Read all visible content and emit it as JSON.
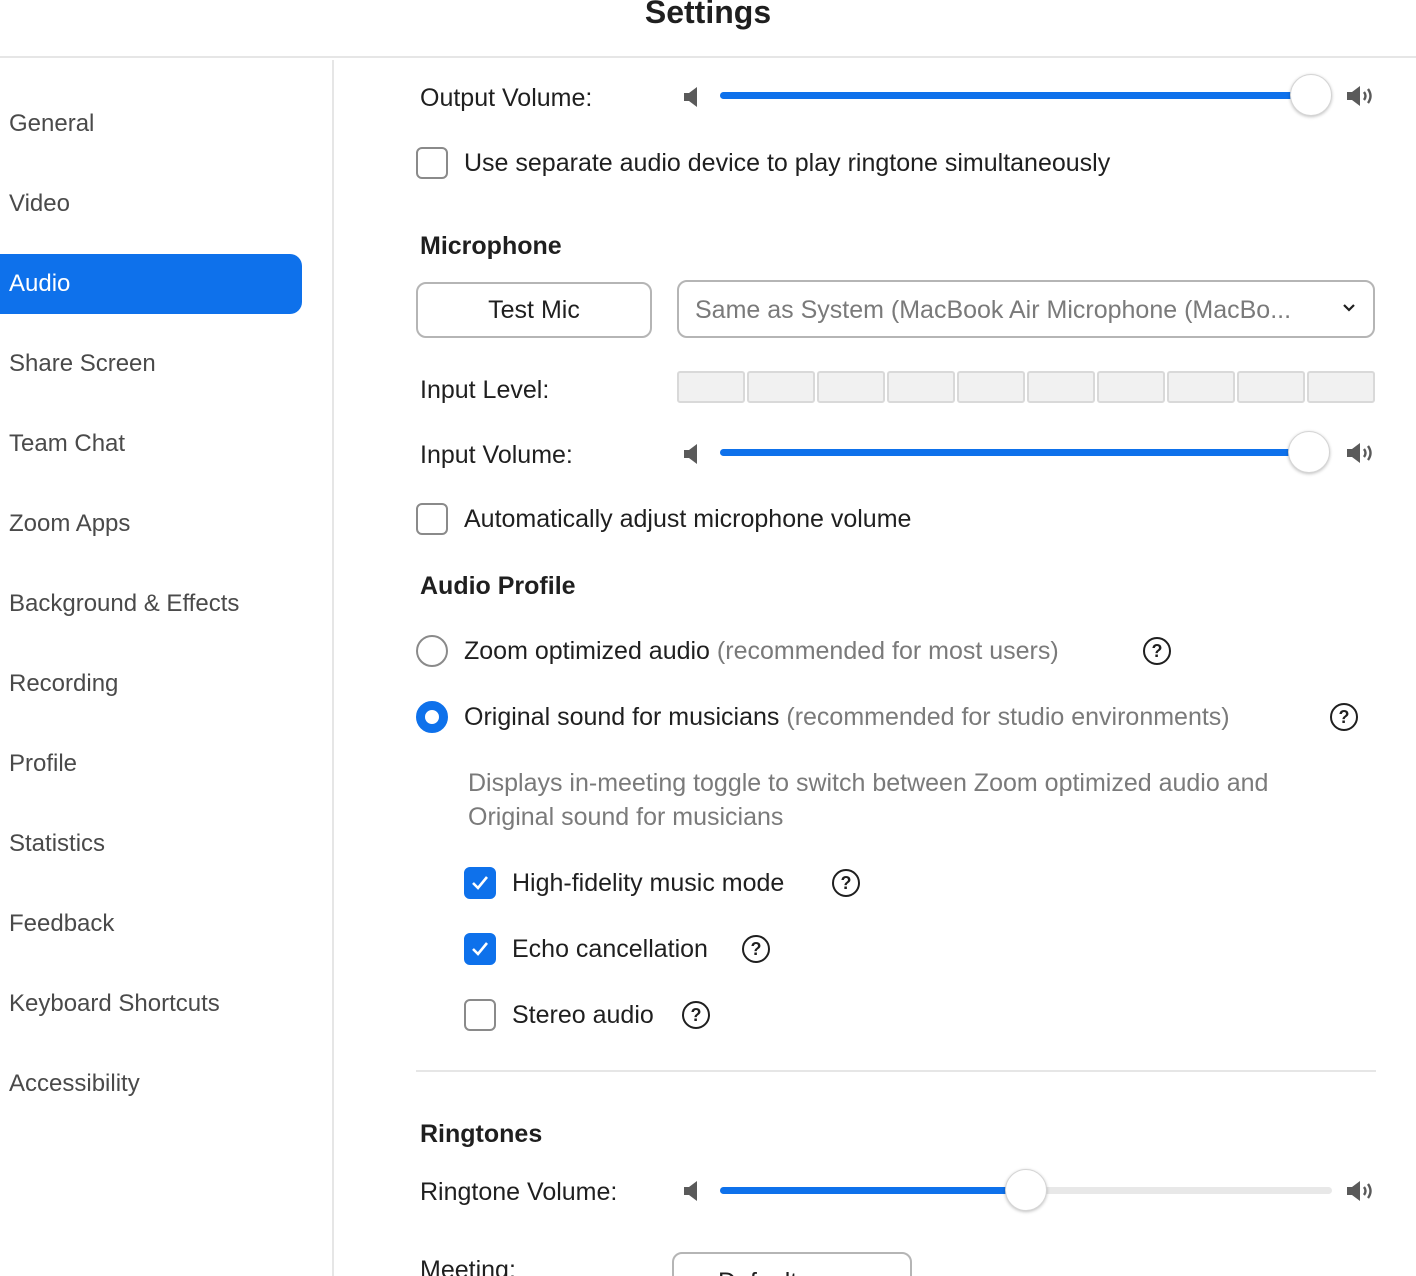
{
  "window": {
    "title": "Settings"
  },
  "sidebar": {
    "items": [
      {
        "label": "General",
        "active": false
      },
      {
        "label": "Video",
        "active": false
      },
      {
        "label": "Audio",
        "active": true
      },
      {
        "label": "Share Screen",
        "active": false
      },
      {
        "label": "Team Chat",
        "active": false
      },
      {
        "label": "Zoom Apps",
        "active": false
      },
      {
        "label": "Background & Effects",
        "active": false
      },
      {
        "label": "Recording",
        "active": false
      },
      {
        "label": "Profile",
        "active": false
      },
      {
        "label": "Statistics",
        "active": false
      },
      {
        "label": "Feedback",
        "active": false
      },
      {
        "label": "Keyboard Shortcuts",
        "active": false
      },
      {
        "label": "Accessibility",
        "active": false
      }
    ]
  },
  "speaker": {
    "output_volume_label": "Output Volume:",
    "output_volume_level": 1.0,
    "separate_device_label": "Use separate audio device to play ringtone simultaneously",
    "separate_device_checked": false
  },
  "microphone": {
    "section_title": "Microphone",
    "test_mic_label": "Test Mic",
    "device_selected": "Same as System (MacBook Air Microphone (MacBo...",
    "input_level_label": "Input Level:",
    "input_level_segments": 10,
    "input_level_active": 0,
    "input_volume_label": "Input Volume:",
    "input_volume_level": 1.0,
    "auto_adjust_label": "Automatically adjust microphone volume",
    "auto_adjust_checked": false
  },
  "audio_profile": {
    "section_title": "Audio Profile",
    "zoom_optimized_label": "Zoom optimized audio",
    "zoom_optimized_hint": "(recommended for most users)",
    "zoom_optimized_selected": false,
    "original_sound_label": "Original sound for musicians",
    "original_sound_hint": "(recommended for studio environments)",
    "original_sound_selected": true,
    "description_line1": "Displays in-meeting toggle to switch between Zoom optimized audio and",
    "description_line2": "Original sound for musicians",
    "options": [
      {
        "label": "High-fidelity music mode",
        "checked": true
      },
      {
        "label": "Echo cancellation",
        "checked": true
      },
      {
        "label": "Stereo audio",
        "checked": false
      }
    ]
  },
  "ringtones": {
    "section_title": "Ringtones",
    "ringtone_volume_label": "Ringtone Volume:",
    "ringtone_volume_level": 0.5,
    "meeting_label": "Meeting:",
    "meeting_value": "Default"
  },
  "icons": {
    "volume_low": "speaker-low-icon",
    "volume_high": "speaker-high-icon",
    "help": "question-circle-icon",
    "dropdown": "chevron-down-icon",
    "check": "checkmark-icon"
  },
  "colors": {
    "accent": "#0e71eb",
    "muted_text": "#7a7a7a"
  }
}
